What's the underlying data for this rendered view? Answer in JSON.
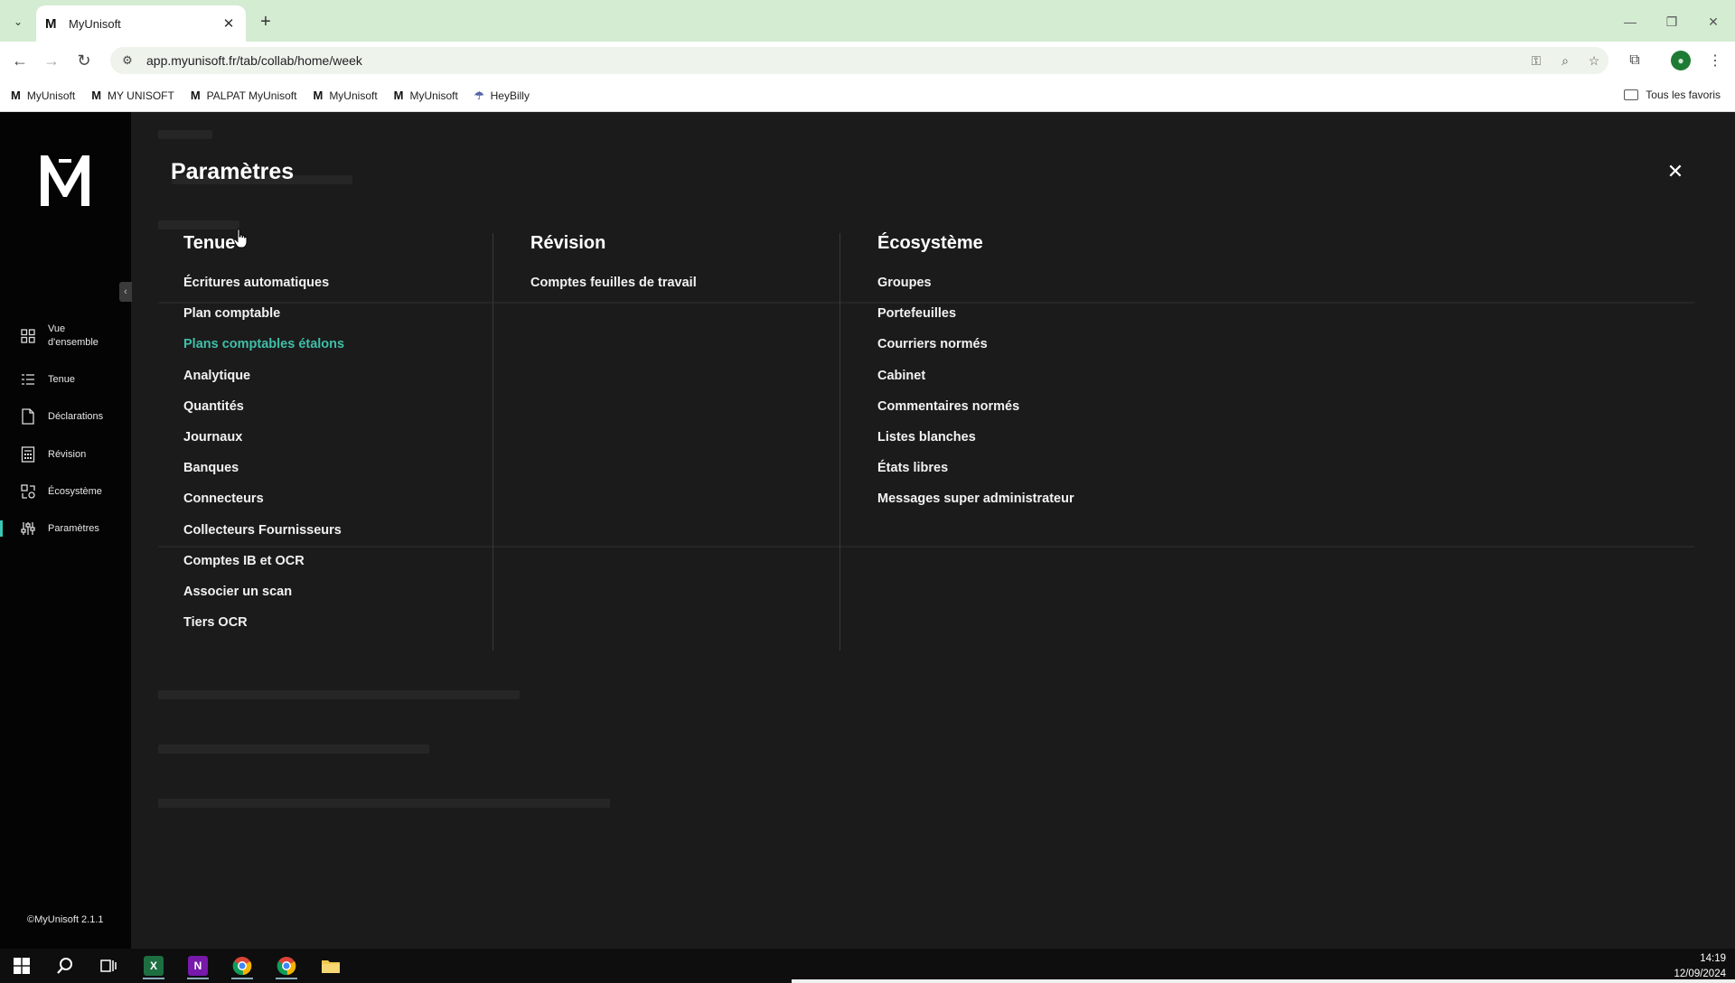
{
  "browser": {
    "tab_title": "MyUnisoft",
    "tab_favicon": "M",
    "new_tab": "+",
    "url": "app.myunisoft.fr/tab/collab/home/week",
    "bookmarks": [
      {
        "icon": "M",
        "label": "MyUnisoft"
      },
      {
        "icon": "M",
        "label": "MY UNISOFT"
      },
      {
        "icon": "M",
        "label": "PALPAT MyUnisoft"
      },
      {
        "icon": "M",
        "label": "MyUnisoft"
      },
      {
        "icon": "M",
        "label": "MyUnisoft"
      },
      {
        "icon": "☂",
        "label": "HeyBilly"
      }
    ],
    "all_bookmarks": "Tous les favoris"
  },
  "sidebar": {
    "items": [
      {
        "label": "Vue d'ensemble",
        "icon": "grid-icon"
      },
      {
        "label": "Tenue",
        "icon": "list-icon"
      },
      {
        "label": "Déclarations",
        "icon": "document-icon"
      },
      {
        "label": "Révision",
        "icon": "calculator-icon"
      },
      {
        "label": "Écosystème",
        "icon": "ecosystem-icon"
      },
      {
        "label": "Paramètres",
        "icon": "sliders-icon",
        "active": true
      }
    ],
    "copyright": "©MyUnisoft 2.1.1"
  },
  "settings": {
    "title": "Paramètres",
    "columns": [
      {
        "title": "Tenue",
        "items": [
          "Écritures automatiques",
          "Plan comptable",
          "Plans comptables étalons",
          "Analytique",
          "Quantités",
          "Journaux",
          "Banques",
          "Connecteurs",
          "Collecteurs Fournisseurs",
          "Comptes IB et OCR",
          "Associer un scan",
          "Tiers OCR"
        ],
        "hovered_index": 2
      },
      {
        "title": "Révision",
        "items": [
          "Comptes feuilles de travail"
        ]
      },
      {
        "title": "Écosystème",
        "items": [
          "Groupes",
          "Portefeuilles",
          "Courriers normés",
          "Cabinet",
          "Commentaires normés",
          "Listes blanches",
          "États libres",
          "Messages super administrateur"
        ]
      }
    ]
  },
  "colors": {
    "accent": "#3fbfa8",
    "overlay_bg": "#1b1b1b",
    "sidebar_bg": "#040404",
    "tabstrip_bg": "#d4ecd2"
  },
  "taskbar": {
    "time": "14:19",
    "date": "12/09/2024"
  }
}
